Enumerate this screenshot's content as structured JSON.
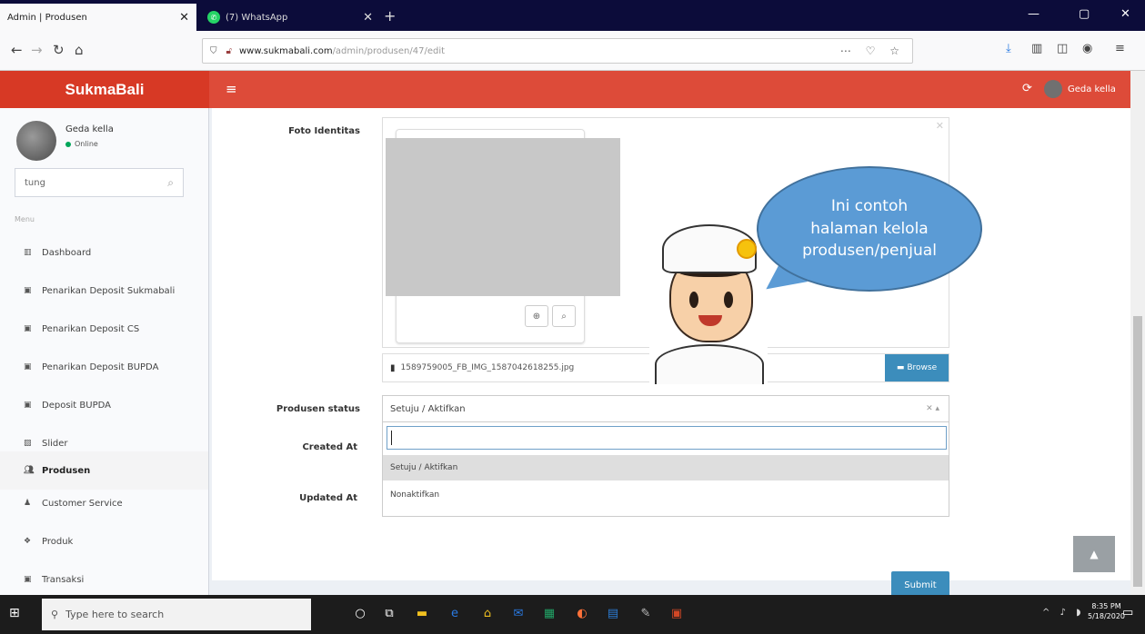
{
  "browser": {
    "tabs": [
      {
        "title": "Admin | Produsen"
      },
      {
        "title": "(7) WhatsApp"
      }
    ],
    "url": {
      "domain": "www.sukmabali.com",
      "path": "/admin/produsen/47/edit"
    }
  },
  "header": {
    "brand": "SukmaBali",
    "username": "Geda kella"
  },
  "sidebar": {
    "user": {
      "name": "Geda kella",
      "status": "Online"
    },
    "search_value": "tung",
    "menu_header": "Menu",
    "items": [
      {
        "label": "Dashboard",
        "icon": "bar-chart-icon"
      },
      {
        "label": "Penarikan Deposit Sukmabali",
        "icon": "money-icon"
      },
      {
        "label": "Penarikan Deposit CS",
        "icon": "money-icon"
      },
      {
        "label": "Penarikan Deposit BUPDA",
        "icon": "money-icon"
      },
      {
        "label": "Deposit BUPDA",
        "icon": "money-icon"
      },
      {
        "label": "Slider",
        "icon": "image-icon"
      },
      {
        "label": "Produsen",
        "icon": "users-icon"
      },
      {
        "label": "Customer Service",
        "icon": "user-icon"
      },
      {
        "label": "Produk",
        "icon": "cubes-icon"
      },
      {
        "label": "Transaksi",
        "icon": "money-icon"
      }
    ],
    "active_item": "Produsen"
  },
  "form": {
    "foto_label": "Foto Identitas",
    "file_name": "1589759005_FB_IMG_1587042618255.jpg",
    "browse_label": "Browse",
    "status_label": "Produsen status",
    "status_value": "Setuju / Aktifkan",
    "status_options": [
      "Setuju / Aktifkan",
      "Nonaktifkan"
    ],
    "created_label": "Created At",
    "updated_label": "Updated At",
    "submit_label": "Submit"
  },
  "callout": {
    "lines": [
      "Ini contoh",
      "halaman kelola",
      "produsen/penjual"
    ]
  },
  "taskbar": {
    "search_placeholder": "Type here to search",
    "time": "8:35 PM",
    "date": "5/18/2020"
  },
  "colors": {
    "header": "#dd4b39",
    "logo_bg": "#d73925",
    "primary_button": "#3c8dbc",
    "callout": "#5b9bd5"
  }
}
